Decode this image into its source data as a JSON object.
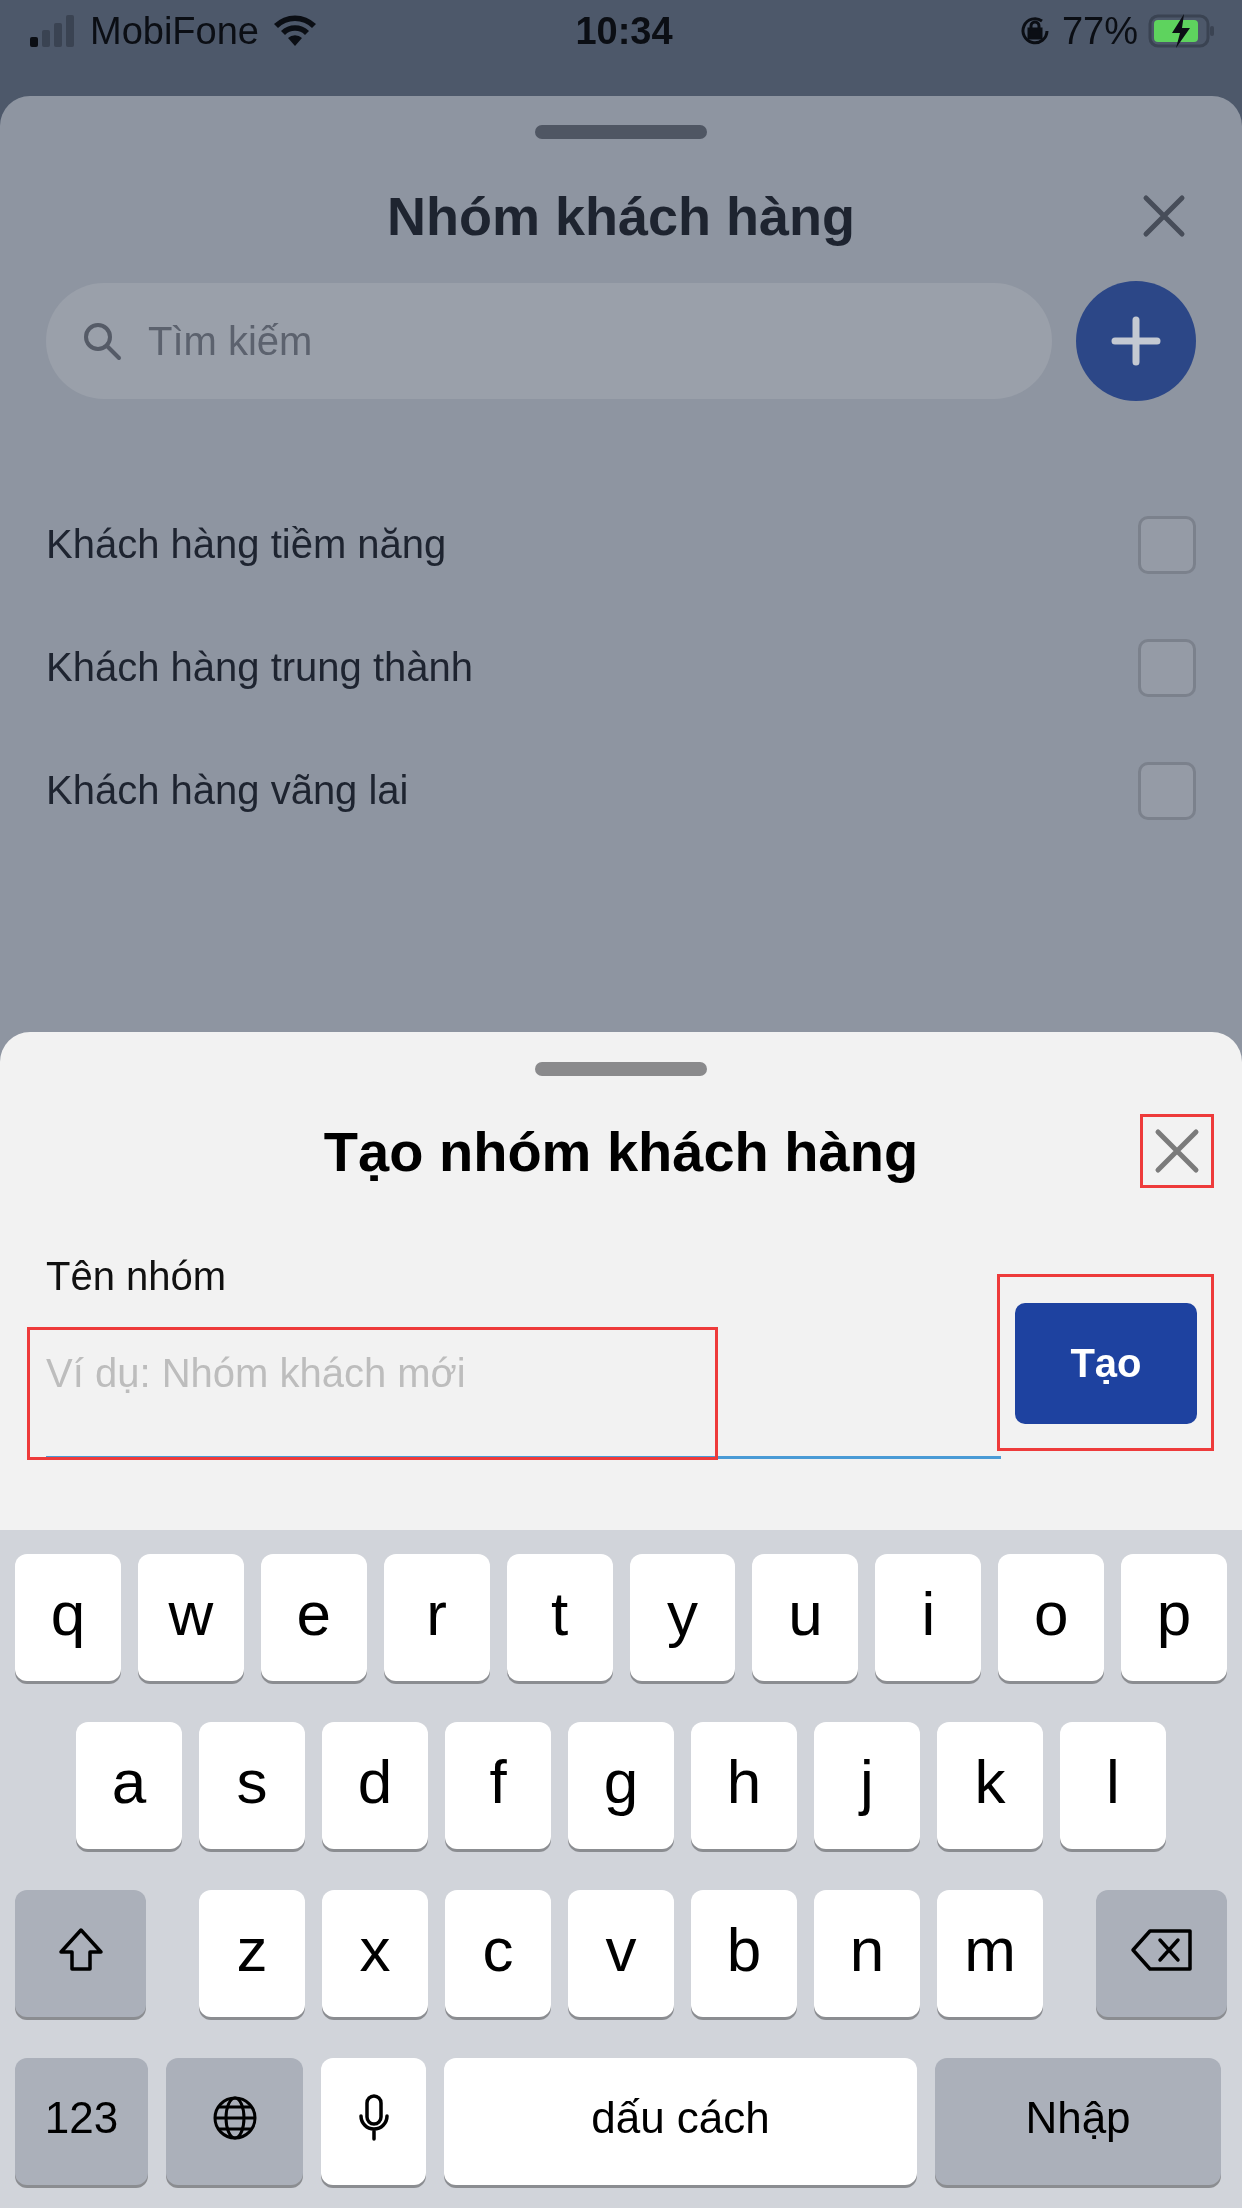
{
  "status_bar": {
    "carrier": "MobiFone",
    "time": "10:34",
    "battery": "77%"
  },
  "group_sheet": {
    "title": "Nhóm khách hàng",
    "search": {
      "placeholder": "Tìm kiếm"
    },
    "items": [
      {
        "label": "Khách hàng tiềm năng",
        "checked": false
      },
      {
        "label": "Khách hàng trung thành",
        "checked": false
      },
      {
        "label": "Khách hàng vãng lai",
        "checked": false
      }
    ]
  },
  "create_sheet": {
    "title": "Tạo nhóm khách hàng",
    "close_highlighted": true,
    "field_label": "Tên nhóm",
    "name_field": {
      "placeholder": "Ví dụ: Nhóm khách mới",
      "highlighted": true
    },
    "create_button": {
      "label": "Tạo",
      "highlighted": true
    }
  },
  "keyboard": {
    "rows": [
      {
        "keys": [
          {
            "kind": "letter",
            "label": "q"
          },
          {
            "kind": "letter",
            "label": "w"
          },
          {
            "kind": "letter",
            "label": "e"
          },
          {
            "kind": "letter",
            "label": "r"
          },
          {
            "kind": "letter",
            "label": "t"
          },
          {
            "kind": "letter",
            "label": "y"
          },
          {
            "kind": "letter",
            "label": "u"
          },
          {
            "kind": "letter",
            "label": "i"
          },
          {
            "kind": "letter",
            "label": "o"
          },
          {
            "kind": "letter",
            "label": "p"
          }
        ]
      },
      {
        "keys": [
          {
            "kind": "letter",
            "label": "a"
          },
          {
            "kind": "letter",
            "label": "s"
          },
          {
            "kind": "letter",
            "label": "d"
          },
          {
            "kind": "letter",
            "label": "f"
          },
          {
            "kind": "letter",
            "label": "g"
          },
          {
            "kind": "letter",
            "label": "h"
          },
          {
            "kind": "letter",
            "label": "j"
          },
          {
            "kind": "letter",
            "label": "k"
          },
          {
            "kind": "letter",
            "label": "l"
          }
        ]
      },
      {
        "keys": [
          {
            "kind": "shift"
          },
          {
            "kind": "letter",
            "label": "z"
          },
          {
            "kind": "letter",
            "label": "x"
          },
          {
            "kind": "letter",
            "label": "c"
          },
          {
            "kind": "letter",
            "label": "v"
          },
          {
            "kind": "letter",
            "label": "b"
          },
          {
            "kind": "letter",
            "label": "n"
          },
          {
            "kind": "letter",
            "label": "m"
          },
          {
            "kind": "backspace"
          }
        ]
      },
      {
        "keys": [
          {
            "kind": "mode",
            "label": "123"
          },
          {
            "kind": "globe"
          },
          {
            "kind": "mic"
          },
          {
            "kind": "space",
            "label": "dấu cách"
          },
          {
            "kind": "return",
            "label": "Nhập"
          }
        ]
      }
    ]
  }
}
